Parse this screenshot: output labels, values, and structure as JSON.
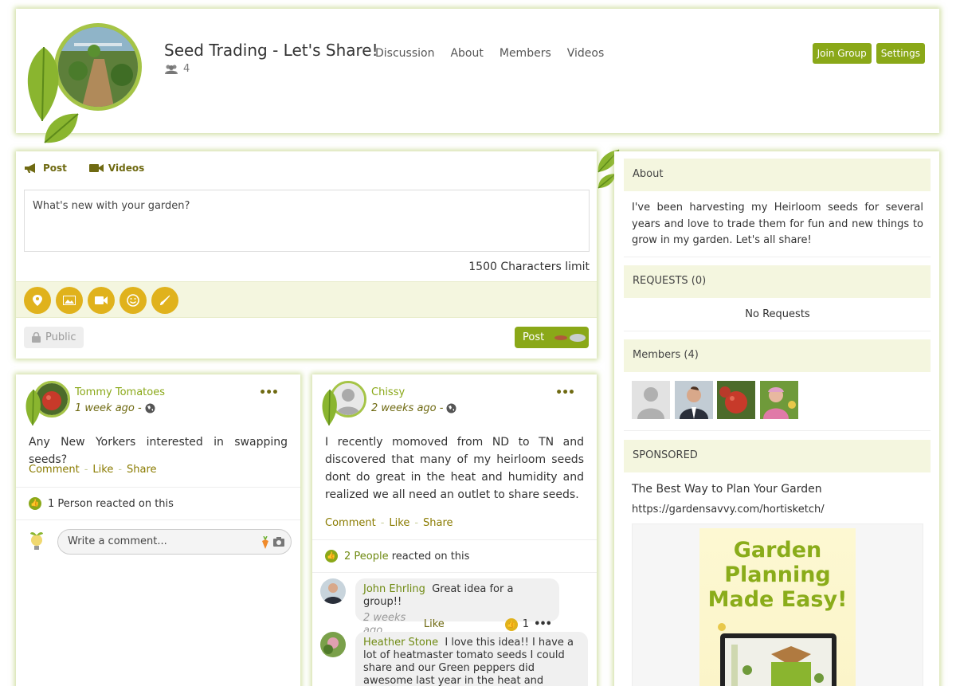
{
  "group": {
    "title": "Seed Trading - Let's Share!",
    "member_count": "4",
    "nav": [
      "Discussion",
      "About",
      "Members",
      "Videos"
    ],
    "join_label": "Join Group",
    "settings_label": "Settings"
  },
  "composer": {
    "tabs": {
      "post": "Post",
      "videos": "Videos"
    },
    "placeholder": "What's new with your garden?",
    "char_limit": "1500 Characters limit",
    "privacy": "Public",
    "post_label": "Post",
    "tools": [
      "location-icon",
      "image-icon",
      "video-icon",
      "emoji-icon",
      "brush-icon"
    ]
  },
  "posts": [
    {
      "author": "Tommy Tomatoes",
      "time": "1 week ago -",
      "text": "Any New Yorkers interested in swapping seeds?",
      "actions": {
        "comment": "Comment",
        "like": "Like",
        "share": "Share",
        "sep": "-"
      },
      "reactions": {
        "count": "1 Person",
        "suffix": "reacted on this"
      },
      "comment_placeholder": "Write a comment..."
    },
    {
      "author": "Chissy",
      "time": "2 weeks ago -",
      "text": "I recently momoved from ND to TN and discovered that many of my heirloom seeds dont do great in the heat and humidity and realized we all need an outlet to share seeds.",
      "actions": {
        "comment": "Comment",
        "like": "Like",
        "share": "Share",
        "sep": "-"
      },
      "reactions": {
        "count": "2 People",
        "suffix": "reacted on this"
      },
      "comments": [
        {
          "name": "John Ehrling",
          "text": "Great idea for a group!!",
          "time": "2 weeks ago",
          "like": "Like",
          "likes": "1"
        },
        {
          "name": "Heather Stone",
          "text": "I love this idea!! I have a lot of heatmaster tomato seeds I could share and our Green peppers did awesome last year in the heat and"
        }
      ]
    }
  ],
  "sidebar": {
    "about_title": "About",
    "about_text": "I've been harvesting my Heirloom seeds for several years and love to trade them for fun and new things to grow in my garden. Let's all share!",
    "requests_title": "REQUESTS (0)",
    "requests_empty": "No Requests",
    "members_title": "Members (4)",
    "sponsored_title": "SPONSORED",
    "ad_title": "The Best Way to Plan Your Garden",
    "ad_url": "https://gardensavvy.com/hortisketch/",
    "ad_image_text": [
      "Garden",
      "Planning",
      "Made Easy!"
    ]
  },
  "colors": {
    "accent": "#8aa818",
    "gold": "#e0b21c",
    "olive": "#6f6a12",
    "panel": "#f4f6df"
  }
}
